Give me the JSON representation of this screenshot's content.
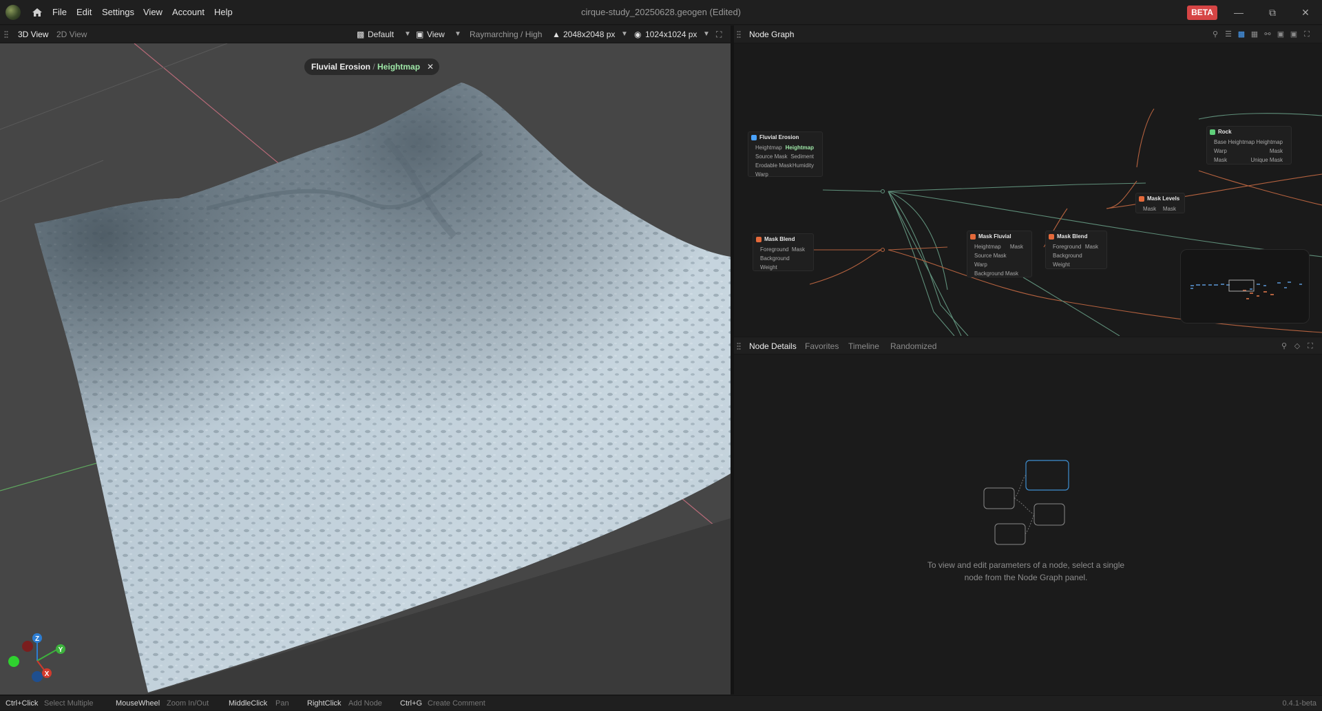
{
  "titlebar": {
    "menu": [
      "File",
      "Edit",
      "Settings",
      "View",
      "Account",
      "Help"
    ],
    "document_title": "cirque-study_20250628.geogen",
    "edited": "(Edited)",
    "beta_label": "BETA",
    "window_controls": [
      "minimize-icon",
      "restore-icon",
      "close-icon"
    ]
  },
  "viewport_bar": {
    "tabs": [
      "3D View",
      "2D View"
    ],
    "preset": "Default",
    "view_label": "View",
    "render_mode": "Raymarching / High",
    "resolution": "2048x2048 px",
    "preview_resolution": "1024x1024 px"
  },
  "viewport": {
    "chip_node": "Fluvial Erosion",
    "chip_sep": " / ",
    "chip_output": "Heightmap",
    "close_glyph": "✕",
    "axis": {
      "x": "X",
      "y": "Y",
      "z": "Z"
    }
  },
  "graph_panel": {
    "title": "Node Graph",
    "nodes": {
      "fluvial": {
        "title": "Fluvial Erosion",
        "inputs": [
          "Heightmap",
          "Source Mask",
          "Erodable Mask",
          "Warp"
        ],
        "outputs": [
          "Heightmap",
          "Sediment",
          "Humidity"
        ]
      },
      "mask_blend_1": {
        "title": "Mask Blend",
        "inputs": [
          "Foreground",
          "Background",
          "Weight"
        ],
        "outputs": [
          "Mask"
        ]
      },
      "mask_fluvial": {
        "title": "Mask Fluvial",
        "inputs": [
          "Heightmap",
          "Source Mask",
          "Warp",
          "Background Mask"
        ],
        "outputs": [
          "Mask"
        ]
      },
      "mask_blend_2": {
        "title": "Mask Blend",
        "inputs": [
          "Foreground",
          "Background",
          "Weight"
        ],
        "outputs": [
          "Mask"
        ]
      },
      "mask_levels": {
        "title": "Mask Levels",
        "inputs": [
          "Mask"
        ],
        "outputs": [
          "Mask"
        ]
      },
      "rock": {
        "title": "Rock",
        "inputs": [
          "Base Heightmap",
          "Warp",
          "Mask"
        ],
        "outputs": [
          "Heightmap",
          "Mask",
          "Unique Mask"
        ]
      }
    }
  },
  "details_panel": {
    "tabs": [
      "Node Details",
      "Favorites",
      "Timeline",
      "Randomized"
    ],
    "hint_line1": "To view and edit parameters of a node, select a single",
    "hint_line2": "node from the Node Graph panel."
  },
  "statusbar": {
    "shortcuts": [
      {
        "key": "Ctrl+Click",
        "desc": "Select Multiple"
      },
      {
        "key": "MouseWheel",
        "desc": "Zoom In/Out"
      },
      {
        "key": "MiddleClick",
        "desc": "Pan"
      },
      {
        "key": "RightClick",
        "desc": "Add Node"
      },
      {
        "key": "Ctrl+G",
        "desc": "Create Comment"
      }
    ],
    "version": "0.4.1-beta"
  },
  "colors": {
    "accent_green": "#9fe8a8",
    "beta_red": "#d64545",
    "link_green": "#5f8f7a",
    "link_orange": "#b5623f",
    "terrain": "#b9c9d4"
  }
}
